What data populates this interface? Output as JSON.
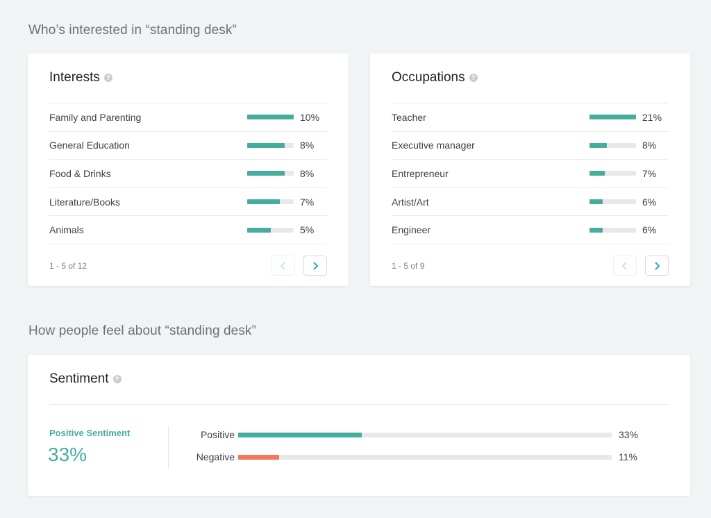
{
  "headings": {
    "who": "Who’s interested in “standing desk”",
    "how": "How people feel about “standing desk”"
  },
  "interests": {
    "title": "Interests",
    "help_icon": "?",
    "items": [
      {
        "label": "Family and Parenting",
        "pct": "10%",
        "fill": 1.0
      },
      {
        "label": "General Education",
        "pct": "8%",
        "fill": 0.8
      },
      {
        "label": "Food & Drinks",
        "pct": "8%",
        "fill": 0.8
      },
      {
        "label": "Literature/Books",
        "pct": "7%",
        "fill": 0.7
      },
      {
        "label": "Animals",
        "pct": "5%",
        "fill": 0.5
      }
    ],
    "pager": "1 - 5 of 12"
  },
  "occupations": {
    "title": "Occupations",
    "help_icon": "?",
    "items": [
      {
        "label": "Teacher",
        "pct": "21%",
        "fill": 1.0
      },
      {
        "label": "Executive manager",
        "pct": "8%",
        "fill": 0.38
      },
      {
        "label": "Entrepreneur",
        "pct": "7%",
        "fill": 0.33
      },
      {
        "label": "Artist/Art",
        "pct": "6%",
        "fill": 0.29
      },
      {
        "label": "Engineer",
        "pct": "6%",
        "fill": 0.29
      }
    ],
    "pager": "1 - 5 of 9"
  },
  "sentiment": {
    "title": "Sentiment",
    "help_icon": "?",
    "positive_label": "Positive Sentiment",
    "positive_value": "33%",
    "rows": [
      {
        "label": "Positive",
        "pct": "33%",
        "fill": 0.33,
        "color": "#45ad9e"
      },
      {
        "label": "Negative",
        "pct": "11%",
        "fill": 0.11,
        "color": "#f2775c"
      }
    ]
  },
  "colors": {
    "accent": "#45ad9e",
    "negative": "#f2775c",
    "pager_arrow": "#2aa6c0",
    "pager_arrow_disabled": "#c3e7ee"
  },
  "icons": {
    "prev": "chevron-left-icon",
    "next": "chevron-right-icon",
    "help": "help-icon"
  }
}
